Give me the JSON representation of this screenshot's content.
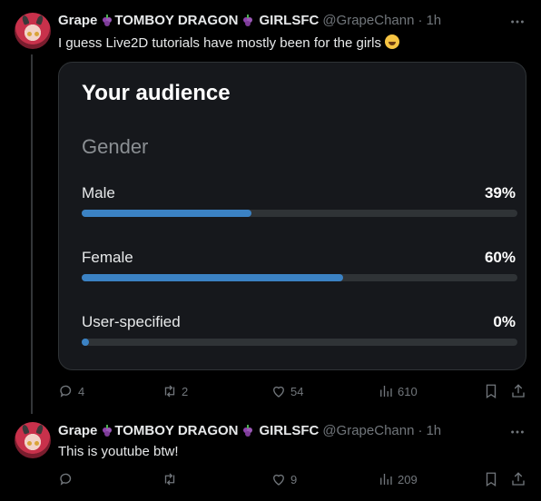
{
  "tweets": [
    {
      "name": "Grape",
      "name_mid": "TOMBOY DRAGON",
      "name_end": "GIRLSFC",
      "handle": "@GrapeChann",
      "dot": "·",
      "time": "1h",
      "text": "I guess Live2D tutorials have mostly been for the girls",
      "emoji": "rolling-on-floor-laughing",
      "actions": {
        "replies": "4",
        "reposts": "2",
        "likes": "54",
        "views": "610"
      }
    },
    {
      "name": "Grape",
      "name_mid": "TOMBOY DRAGON",
      "name_end": "GIRLSFC",
      "handle": "@GrapeChann",
      "dot": "·",
      "time": "1h",
      "text": "This is youtube btw!",
      "actions": {
        "replies": "",
        "reposts": "",
        "likes": "9",
        "views": "209"
      }
    }
  ],
  "card": {
    "title": "Your audience",
    "subtitle": "Gender",
    "stats": [
      {
        "label": "Male",
        "value": "39%",
        "fill_fraction": 0.39
      },
      {
        "label": "Female",
        "value": "60%",
        "fill_fraction": 0.6
      },
      {
        "label": "User-specified",
        "value": "0%",
        "fill_fraction": 0.0
      }
    ]
  },
  "colors": {
    "accent": "#3b82c4",
    "muted": "#71767b",
    "background": "#000000"
  }
}
